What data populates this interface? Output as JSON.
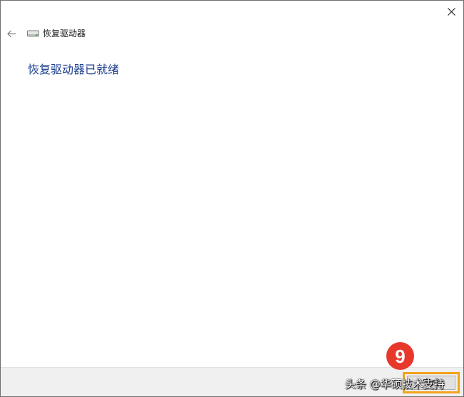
{
  "window": {
    "close_icon": "close-icon"
  },
  "nav": {
    "back_icon": "back-arrow-icon"
  },
  "header": {
    "icon": "drive-icon",
    "title": "恢复驱动器"
  },
  "main": {
    "heading": "恢复驱动器已就绪"
  },
  "footer": {
    "finish_label": "完成",
    "highlight_color": "#f2a21c"
  },
  "annotation": {
    "step_number": "9",
    "step_color": "#e8382b"
  },
  "watermark": {
    "text": "头条 @华硕技术支持"
  }
}
